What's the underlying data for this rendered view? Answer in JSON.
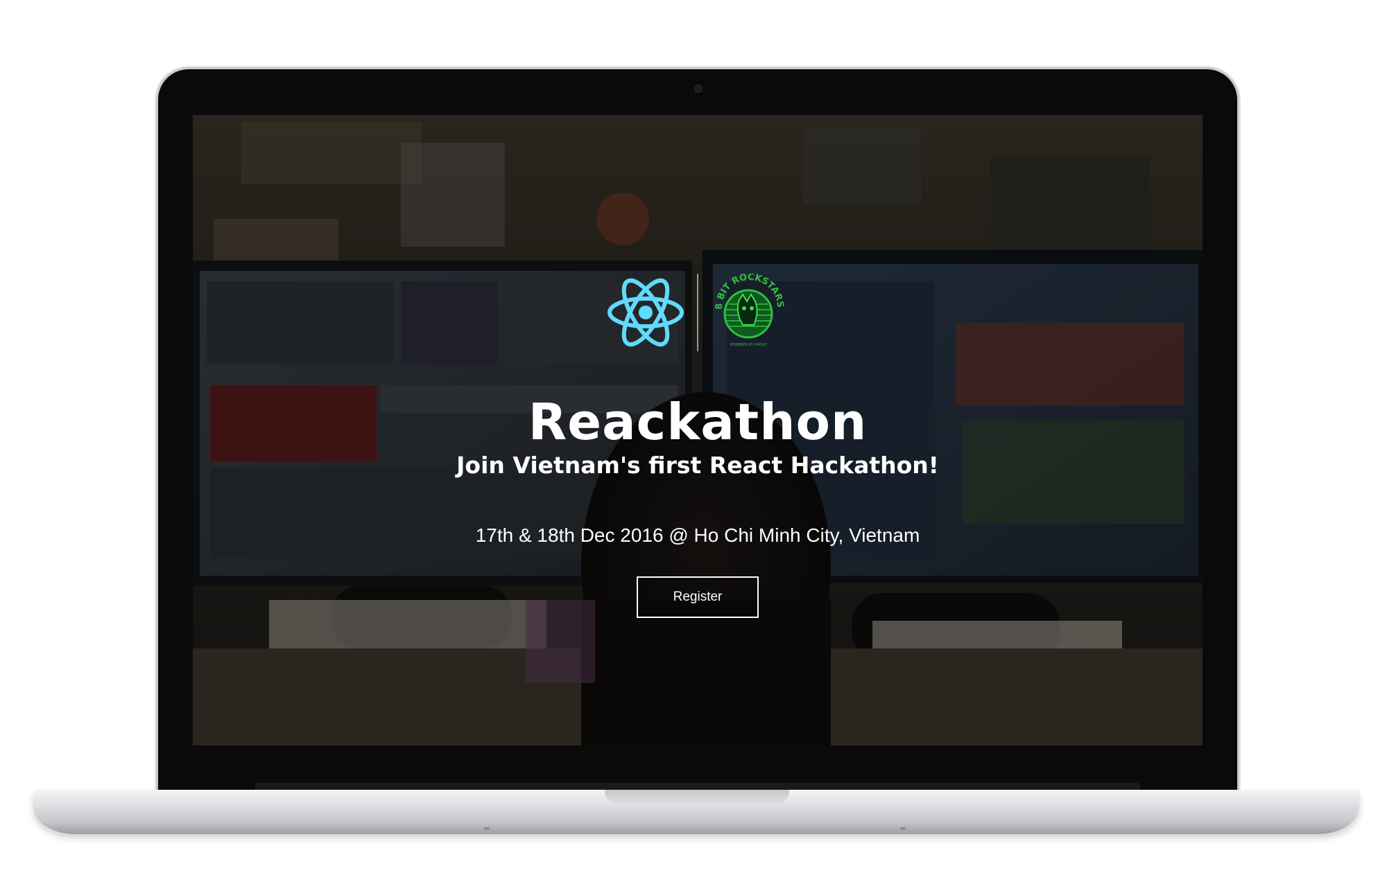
{
  "hero": {
    "title": "Reackathon",
    "subtitle": "Join Vietnam's first React Hackathon!",
    "date_location": "17th & 18th Dec 2016 @ Ho Chi Minh City, Vietnam",
    "register_label": "Register"
  },
  "logos": {
    "react_logo": "react-atom-icon",
    "partner_logo_text": "8 BIT ROCKSTARS",
    "partner_logo_subtext": "POWERED BY GROUP"
  },
  "colors": {
    "react_blue": "#61dafb",
    "rockstars_green": "#2fbf3f",
    "overlay": "#000000"
  }
}
